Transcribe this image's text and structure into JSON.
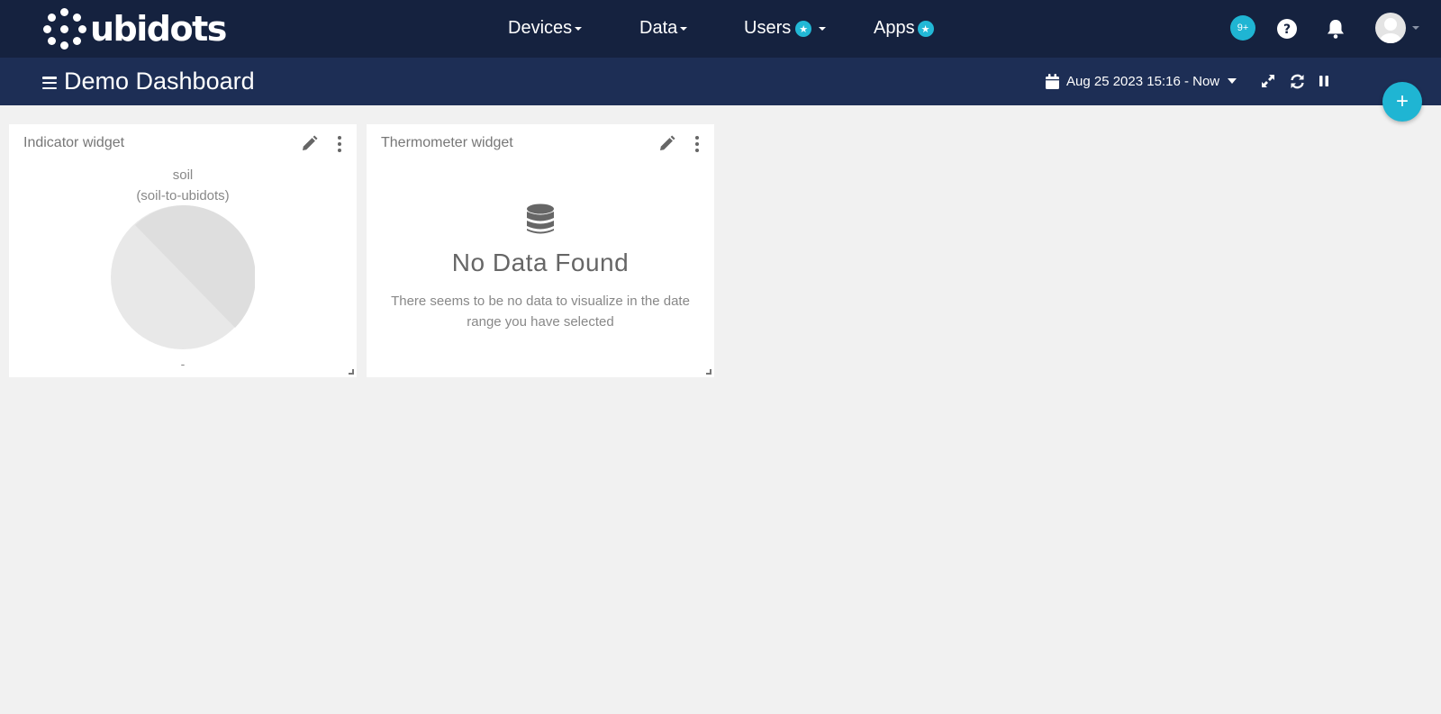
{
  "brand": {
    "name": "ubidots"
  },
  "nav": {
    "devices": "Devices",
    "data": "Data",
    "users": "Users",
    "apps": "Apps"
  },
  "header": {
    "notification_count": "9+",
    "help_icon": "question-circle-icon",
    "bell_icon": "bell-icon"
  },
  "dashboard": {
    "title": "Demo Dashboard",
    "date_range": "Aug 25 2023 15:16 - Now",
    "add_button": "+"
  },
  "widgets": [
    {
      "title": "Indicator widget",
      "variable": "soil",
      "device": "(soil-to-ubidots)",
      "value": "-"
    },
    {
      "title": "Thermometer widget",
      "empty_title": "No Data Found",
      "empty_text": "There seems to be no data to visualize in the date range you have selected"
    }
  ],
  "colors": {
    "navbar": "#15223f",
    "subbar": "#1d2e55",
    "accent": "#1fb5d3",
    "background": "#f1f1f1"
  }
}
